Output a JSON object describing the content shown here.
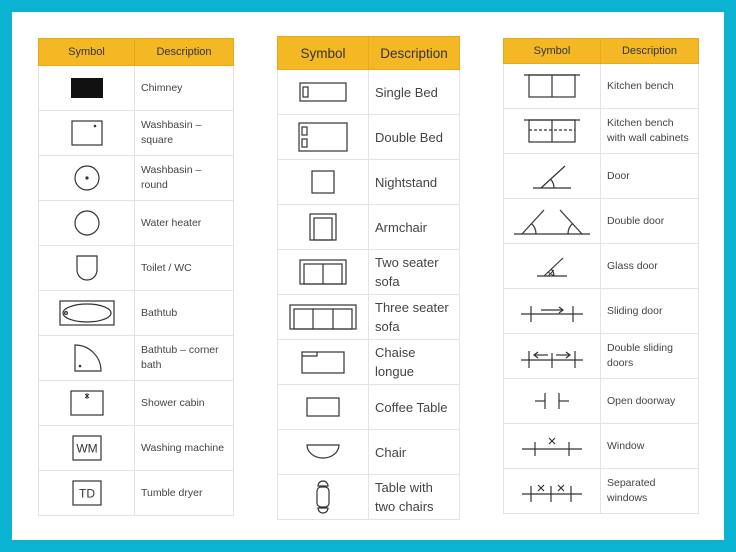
{
  "tables": [
    {
      "header": {
        "symbol": "Symbol",
        "description": "Description"
      },
      "rows": [
        {
          "icon": "chimney-icon",
          "label": "Chimney"
        },
        {
          "icon": "washbasin-square-icon",
          "label": "Washbasin – square"
        },
        {
          "icon": "washbasin-round-icon",
          "label": "Washbasin – round"
        },
        {
          "icon": "water-heater-icon",
          "label": "Water heater"
        },
        {
          "icon": "toilet-icon",
          "label": "Toilet / WC"
        },
        {
          "icon": "bathtub-icon",
          "label": "Bathtub"
        },
        {
          "icon": "bathtub-corner-icon",
          "label": "Bathtub – corner bath"
        },
        {
          "icon": "shower-cabin-icon",
          "label": "Shower cabin"
        },
        {
          "icon": "washing-machine-icon",
          "label": "Washing machine",
          "symbol_text": "WM"
        },
        {
          "icon": "tumble-dryer-icon",
          "label": "Tumble dryer",
          "symbol_text": "TD"
        }
      ]
    },
    {
      "header": {
        "symbol": "Symbol",
        "description": "Description"
      },
      "rows": [
        {
          "icon": "single-bed-icon",
          "label": "Single Bed"
        },
        {
          "icon": "double-bed-icon",
          "label": "Double Bed"
        },
        {
          "icon": "nightstand-icon",
          "label": "Nightstand"
        },
        {
          "icon": "armchair-icon",
          "label": "Armchair"
        },
        {
          "icon": "two-seater-sofa-icon",
          "label": "Two seater sofa"
        },
        {
          "icon": "three-seater-sofa-icon",
          "label": "Three seater sofa"
        },
        {
          "icon": "chaise-longue-icon",
          "label": "Chaise longue"
        },
        {
          "icon": "coffee-table-icon",
          "label": "Coffee Table"
        },
        {
          "icon": "chair-icon",
          "label": "Chair"
        },
        {
          "icon": "table-with-two-chairs-icon",
          "label": "Table with two chairs"
        }
      ]
    },
    {
      "header": {
        "symbol": "Symbol",
        "description": "Description"
      },
      "rows": [
        {
          "icon": "kitchen-bench-icon",
          "label": "Kitchen bench"
        },
        {
          "icon": "kitchen-bench-wall-cabinets-icon",
          "label": "Kitchen bench with wall cabinets"
        },
        {
          "icon": "door-icon",
          "label": "Door"
        },
        {
          "icon": "double-door-icon",
          "label": "Double door"
        },
        {
          "icon": "glass-door-icon",
          "label": "Glass door"
        },
        {
          "icon": "sliding-door-icon",
          "label": "Sliding door"
        },
        {
          "icon": "double-sliding-doors-icon",
          "label": "Double sliding doors"
        },
        {
          "icon": "open-doorway-icon",
          "label": "Open doorway"
        },
        {
          "icon": "window-icon",
          "label": "Window"
        },
        {
          "icon": "separated-windows-icon",
          "label": "Separated windows"
        }
      ]
    }
  ],
  "colors": {
    "frame": "#0ab3d2",
    "header_bg": "#f5b825",
    "header_border": "#e7a81c",
    "grid": "#e3e3e3",
    "ink": "#333333"
  }
}
